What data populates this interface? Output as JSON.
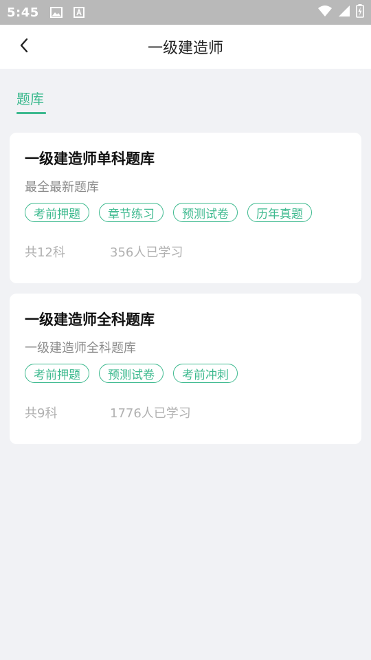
{
  "status_bar": {
    "time": "5:45",
    "left_icons": [
      "image-icon",
      "text-icon"
    ],
    "right_icons": [
      "wifi-icon",
      "signal-icon",
      "battery-icon"
    ]
  },
  "app_bar": {
    "title": "一级建造师",
    "back_icon": "chevron-left-icon"
  },
  "tabs": [
    {
      "label": "题库",
      "active": true
    }
  ],
  "cards": [
    {
      "title": "一级建造师单科题库",
      "subtitle": "最全最新题库",
      "tags": [
        "考前押题",
        "章节练习",
        "预测试卷",
        "历年真题"
      ],
      "count": "共12科",
      "learners": "356人已学习"
    },
    {
      "title": "一级建造师全科题库",
      "subtitle": "一级建造师全科题库",
      "tags": [
        "考前押题",
        "预测试卷",
        "考前冲刺"
      ],
      "count": "共9科",
      "learners": "1776人已学习"
    }
  ],
  "colors": {
    "accent": "#3cb98e",
    "background": "#f1f2f5",
    "status_bar": "#b9b9b9"
  }
}
